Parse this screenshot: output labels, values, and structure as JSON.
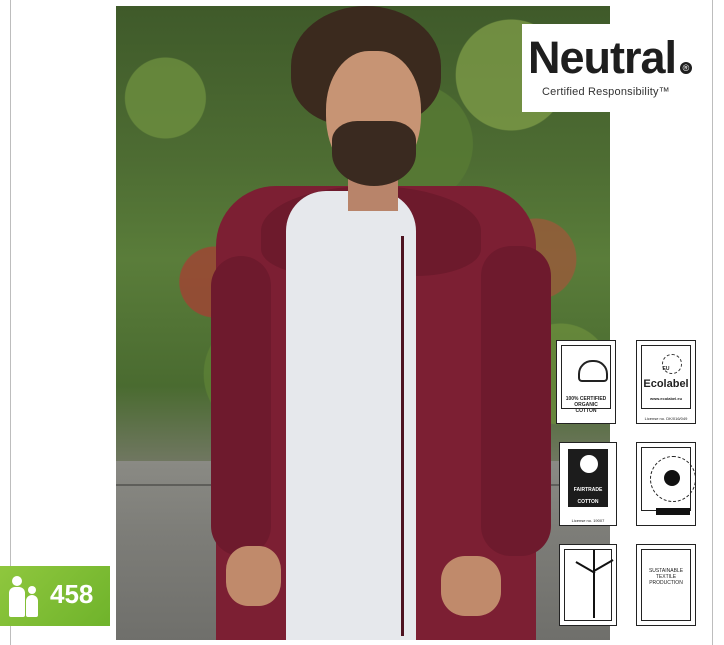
{
  "brand": {
    "name": "Neutral",
    "registered_mark": "®",
    "tagline": "Certified Responsibility™"
  },
  "certifications": {
    "organic_cotton": "100% CERTIFIED ORGANIC COTTON",
    "ecolabel_top": "EU",
    "ecolabel_name": "Ecolabel",
    "ecolabel_url": "www.ecolabel.eu",
    "ecolabel_license": "License no. DK/016/049",
    "fairtrade_name": "FAIRTRADE",
    "fairtrade_product": "COTTON",
    "fairtrade_license": "License no. 19007",
    "oeko_text": "",
    "step_text": "SUSTAINABLE TEXTILE PRODUCTION"
  },
  "page": {
    "number": "458"
  }
}
